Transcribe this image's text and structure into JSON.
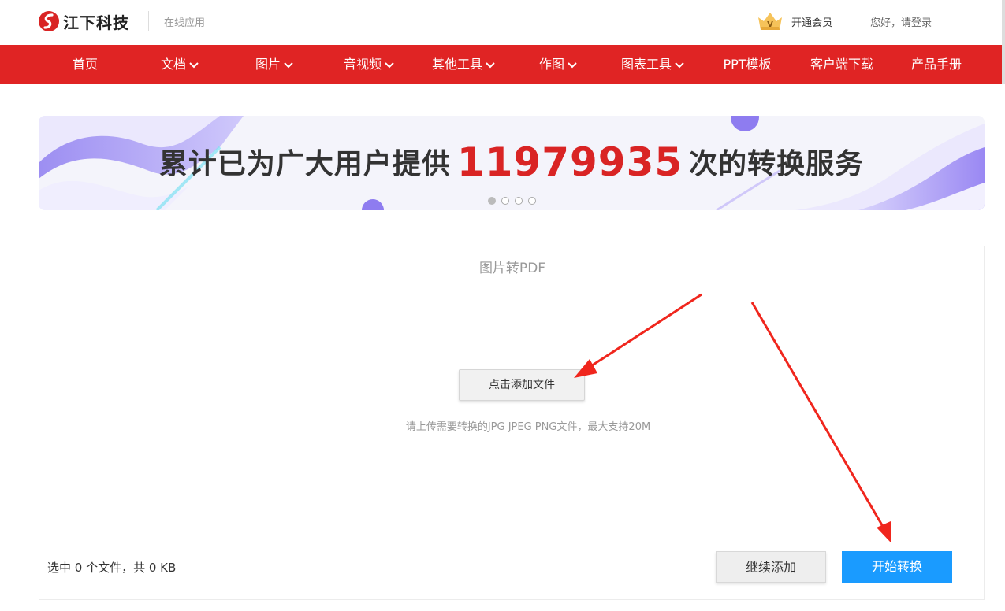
{
  "header": {
    "brand": "江下科技",
    "subtitle": "在线应用",
    "vip_label": "开通会员",
    "login_label": "您好，请登录"
  },
  "nav": {
    "items": [
      {
        "label": "首页",
        "has_dropdown": false
      },
      {
        "label": "文档",
        "has_dropdown": true
      },
      {
        "label": "图片",
        "has_dropdown": true
      },
      {
        "label": "音视频",
        "has_dropdown": true
      },
      {
        "label": "其他工具",
        "has_dropdown": true
      },
      {
        "label": "作图",
        "has_dropdown": true
      },
      {
        "label": "图表工具",
        "has_dropdown": true
      },
      {
        "label": "PPT模板",
        "has_dropdown": false
      },
      {
        "label": "客户端下载",
        "has_dropdown": false
      },
      {
        "label": "产品手册",
        "has_dropdown": false
      }
    ]
  },
  "banner": {
    "text_before": "累计已为广大用户提供",
    "count": "11979935",
    "text_after": "次的转换服务",
    "slide_count": 4,
    "active_slide": 1
  },
  "converter": {
    "title": "图片转PDF",
    "add_file_label": "点击添加文件",
    "hint": "请上传需要转换的JPG JPEG PNG文件，最大支持20M",
    "status": "选中 0 个文件，共 0 KB",
    "continue_label": "继续添加",
    "start_label": "开始转换"
  },
  "colors": {
    "nav_bg": "#e02424",
    "accent_number": "#d92424",
    "primary_button": "#1a9bff",
    "annotation_arrow": "#f0261d"
  },
  "icons": [
    "logo-icon",
    "crown-icon",
    "chevron-down-icon"
  ]
}
